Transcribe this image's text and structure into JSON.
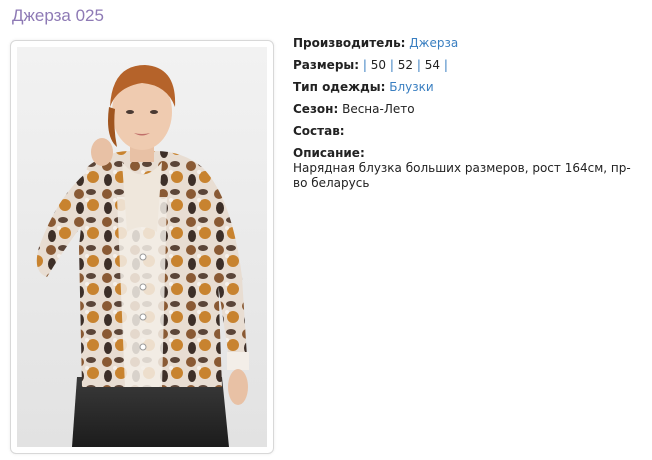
{
  "product": {
    "title": "Джерза 025"
  },
  "photo": {
    "alt": "Нарядная блузка"
  },
  "details": {
    "manufacturer_label": "Производитель:",
    "manufacturer_value": "Джерза",
    "sizes_label": "Размеры:",
    "sizes": [
      "50",
      "52",
      "54"
    ],
    "type_label": "Тип одежды:",
    "type_value": "Блузки",
    "season_label": "Сезон:",
    "season_value": "Весна-Лето",
    "composition_label": "Состав:",
    "description_label": "Описание:",
    "description_value": "Нарядная блузка больших размеров, рост 164см, пр-во беларусь"
  },
  "colors": {
    "title": "#8e7ab5",
    "link": "#3a7fc1"
  }
}
